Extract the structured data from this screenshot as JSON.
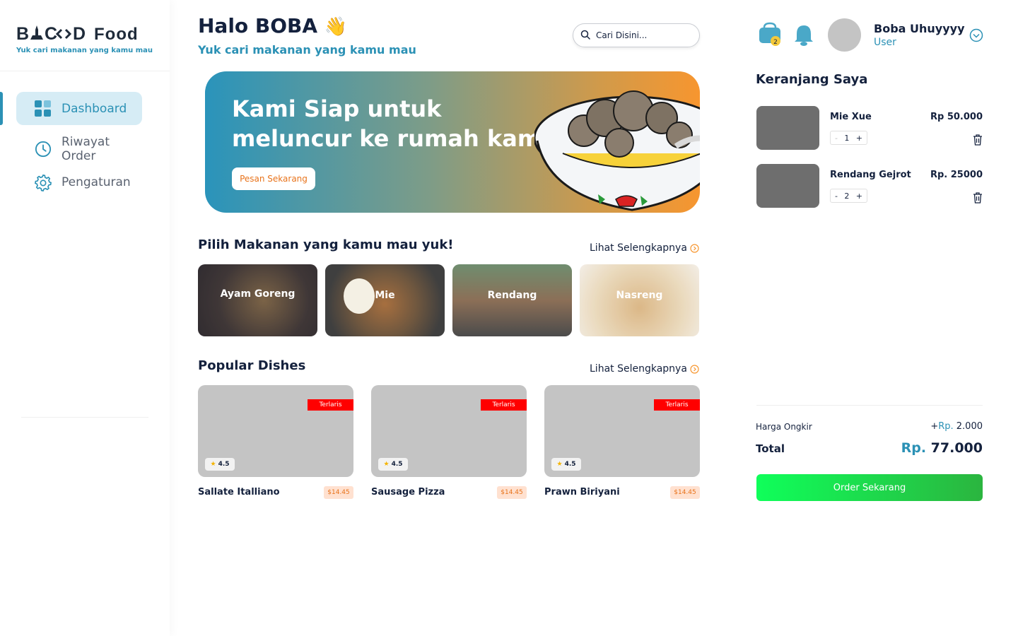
{
  "brand": {
    "name": "B⯊ C‹› D Food",
    "logo_text": "BACOD Food",
    "tagline": "Yuk cari makanan yang kamu mau"
  },
  "sidebar": {
    "items": [
      {
        "label": "Dashboard",
        "icon": "dashboard-grid-icon",
        "active": true
      },
      {
        "label": "Riwayat Order",
        "icon": "clock-icon",
        "active": false
      },
      {
        "label": "Pengaturan",
        "icon": "gear-icon",
        "active": false
      }
    ]
  },
  "header": {
    "greeting": "Halo BOBA",
    "greeting_emoji": "👋",
    "subtitle": "Yuk cari makanan yang kamu mau",
    "search_placeholder": "Cari Disini..."
  },
  "banner": {
    "title": "Kami Siap untuk meluncur ke rumah kamu",
    "button_label": "Pesan Sekarang"
  },
  "categories": {
    "title": "Pilih Makanan yang kamu mau yuk!",
    "see_more": "Lihat Selengkapnya",
    "items": [
      {
        "label": "Ayam Goreng"
      },
      {
        "label": "Mie"
      },
      {
        "label": "Rendang"
      },
      {
        "label": "Nasreng"
      }
    ]
  },
  "popular": {
    "title": "Popular Dishes",
    "see_more": "Lihat Selengkapnya",
    "items": [
      {
        "name": "Sallate Italliano",
        "price": "$14.45",
        "rating": "4.5",
        "badge": "Terlaris"
      },
      {
        "name": "Sausage Pizza",
        "price": "$14.45",
        "rating": "4.5",
        "badge": "Terlaris"
      },
      {
        "name": "Prawn Biriyani",
        "price": "$14.45",
        "rating": "4.5",
        "badge": "Terlaris"
      }
    ]
  },
  "user": {
    "name": "Boba Uhuyyyy",
    "role": "User",
    "cart_count": "2"
  },
  "cart": {
    "title": "Keranjang Saya",
    "items": [
      {
        "name": "Mie Xue",
        "price": "Rp 50.000",
        "qty": "1"
      },
      {
        "name": "Rendang Gejrot",
        "price": "Rp. 25000",
        "qty": "2"
      }
    ],
    "shipping_label": "Harga Ongkir",
    "shipping_prefix": "+",
    "shipping_currency": "Rp.",
    "shipping_value": " 2.000",
    "total_label": "Total",
    "total_currency": "Rp.",
    "total_value": " 77.000",
    "order_button": "Order Sekarang"
  },
  "colors": {
    "accent": "#2b91b5",
    "orange": "#f7962f",
    "badge": "#ff0000",
    "order_green": "#14e04c"
  }
}
